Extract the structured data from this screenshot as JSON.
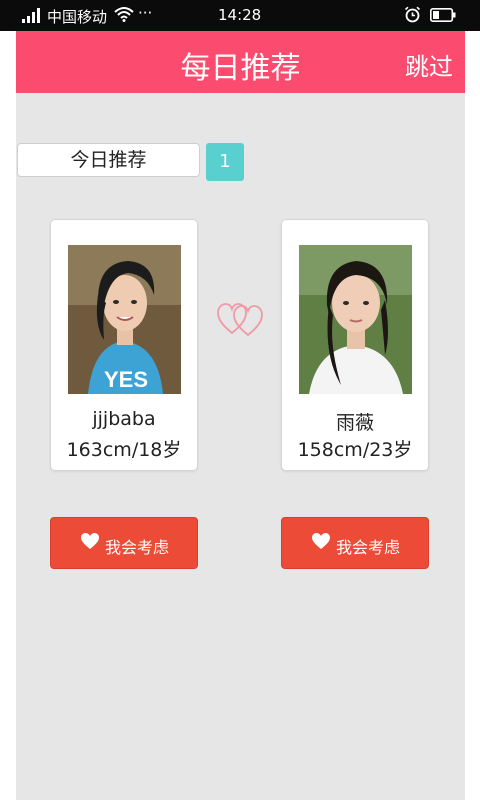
{
  "status_bar": {
    "carrier": "中国移动",
    "more": "···",
    "time": "14:28"
  },
  "header": {
    "title": "每日推荐",
    "skip_label": "跳过",
    "color": "#fb4b6f"
  },
  "recommend": {
    "label": "今日推荐",
    "count": "1",
    "count_color": "#5acfd0"
  },
  "profiles": [
    {
      "name": "jjjbaba",
      "meta": "163cm/18岁"
    },
    {
      "name": "雨薇",
      "meta": "158cm/23岁"
    }
  ],
  "actions": {
    "consider_label": "我会考虑",
    "button_color": "#ec4b37"
  },
  "icons": {
    "signal": "signal-icon",
    "wifi": "wifi-icon",
    "alarm": "alarm-icon",
    "battery": "battery-icon",
    "match": "double-heart-icon",
    "like": "heart-icon"
  }
}
